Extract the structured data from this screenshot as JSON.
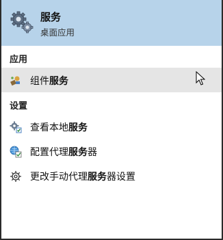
{
  "best_match": {
    "title": "服务",
    "subtitle": "桌面应用",
    "icon": "gears-icon"
  },
  "sections": {
    "apps": "应用",
    "settings": "设置"
  },
  "apps": [
    {
      "prefix": "组件",
      "match": "服务",
      "suffix": "",
      "icon": "component-services-icon"
    }
  ],
  "settings": [
    {
      "prefix": "查看本地",
      "match": "服务",
      "suffix": "",
      "icon": "view-services-icon"
    },
    {
      "prefix": "配置代理",
      "match": "服务",
      "suffix": "器",
      "icon": "proxy-config-icon"
    },
    {
      "prefix": "更改手动代理",
      "match": "服务",
      "suffix": "器设置",
      "icon": "gear-icon"
    }
  ],
  "colors": {
    "best_match_bg": "#b7d3ea",
    "hover_bg": "#e5e5e5",
    "frame": "#2b2b2b"
  }
}
